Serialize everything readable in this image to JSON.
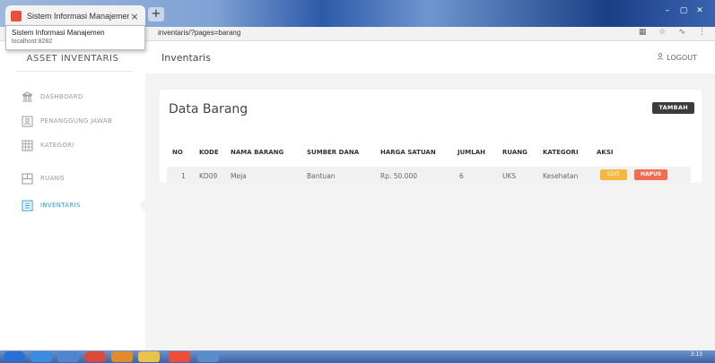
{
  "browser": {
    "tab_title": "Sistem Informasi Manajemen",
    "url": "inventaris/?pages=barang",
    "tooltip_title": "Sistem Informasi Manajemen",
    "tooltip_url": "localhost:8282",
    "clock": "3:13"
  },
  "sidebar": {
    "brand": "ASSET INVENTARIS",
    "items": [
      {
        "label": "DASHBOARD",
        "icon": "bank-icon",
        "active": false
      },
      {
        "label": "PENANGGUNG JAWAB",
        "icon": "user-card-icon",
        "active": false
      },
      {
        "label": "KATEGORI",
        "icon": "grid-icon",
        "active": false
      },
      {
        "label": "RUANG",
        "icon": "room-icon",
        "active": false
      },
      {
        "label": "INVENTARIS",
        "icon": "list-icon",
        "active": true
      }
    ]
  },
  "header": {
    "page_title": "Inventaris",
    "logout_label": "LOGOUT"
  },
  "card": {
    "title": "Data Barang",
    "add_label": "TAMBAH",
    "columns": [
      "NO",
      "KODE",
      "NAMA BARANG",
      "SUMBER DANA",
      "HARGA SATUAN",
      "JUMLAH",
      "RUANG",
      "KATEGORI",
      "AKSI"
    ],
    "rows": [
      {
        "no": "1",
        "kode": "KD09",
        "nama": "Meja",
        "sumber": "Bantuan",
        "harga": "Rp. 50.000",
        "jumlah": "6",
        "ruang": "UKS",
        "kategori": "Kesehatan",
        "edit_label": "EDIT",
        "hapus_label": "HAPUS"
      }
    ]
  },
  "colors": {
    "accent": "#2f9be0",
    "edit": "#f6b73c",
    "hapus": "#f26d4f",
    "add_button": "#3c3c3c"
  }
}
